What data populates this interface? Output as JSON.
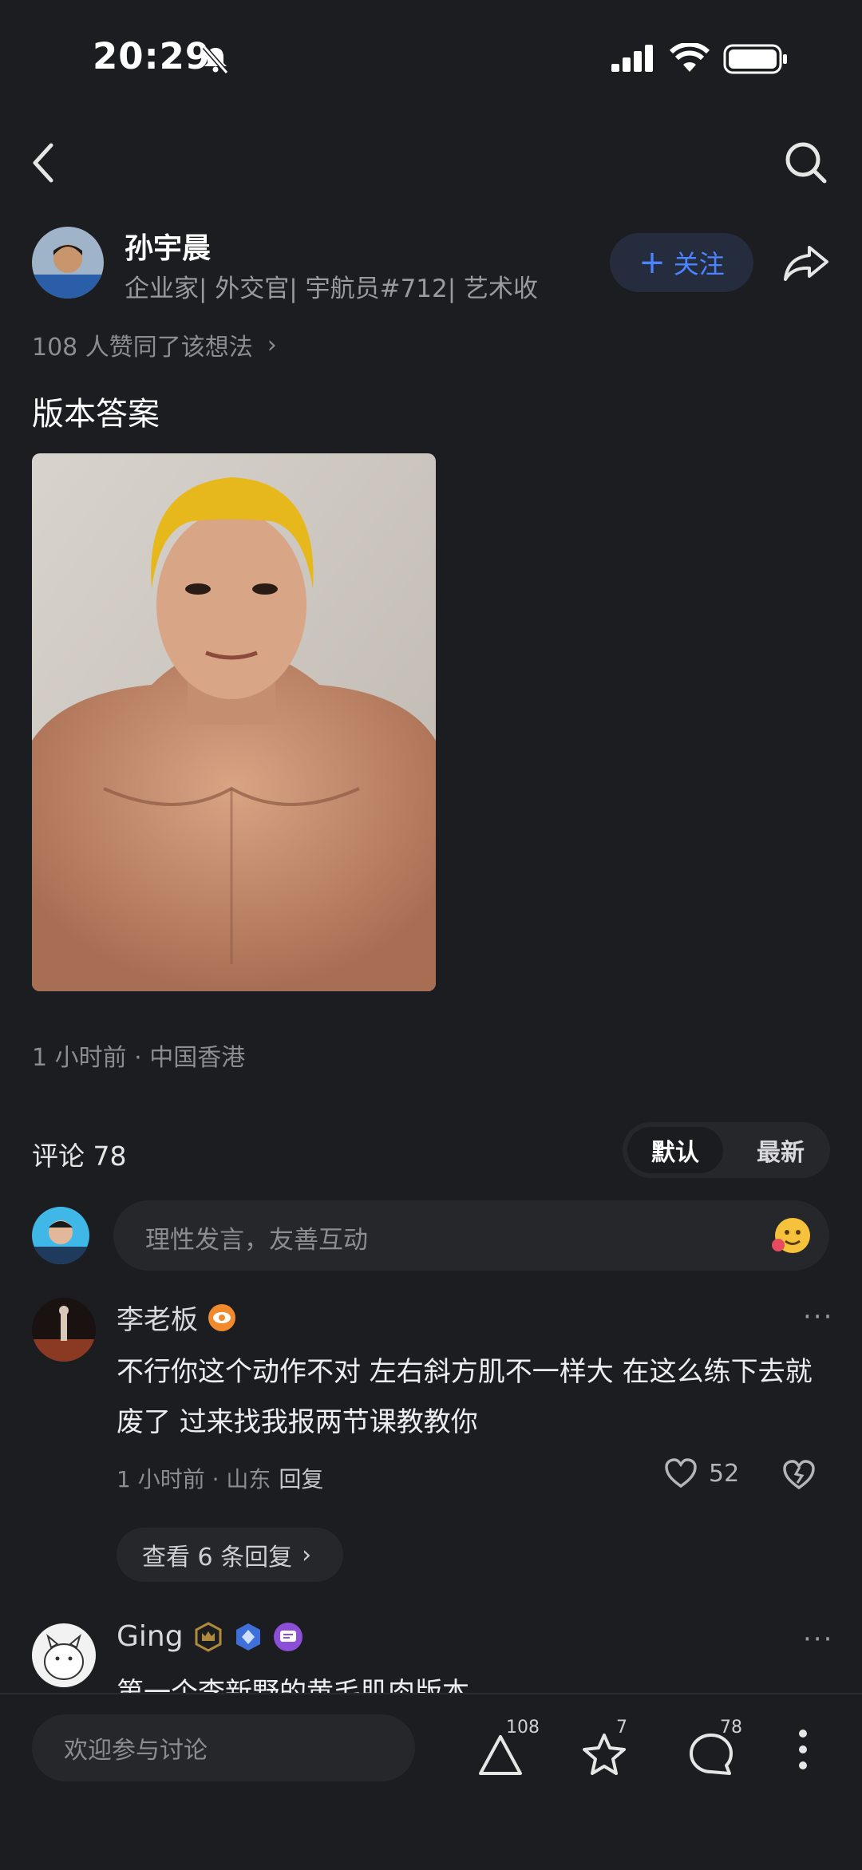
{
  "status_bar": {
    "time": "20:29"
  },
  "author": {
    "name": "孙宇晨",
    "bio": "企业家| 外交官| 宇航员#712| 艺术收",
    "follow_label": "关注"
  },
  "likes_summary": "108 人赞同了该想法",
  "post": {
    "text": "版本答案",
    "meta": "1 小时前 · 中国香港"
  },
  "comments": {
    "header": "评论 78",
    "sort_options": [
      "默认",
      "最新"
    ],
    "input_placeholder": "理性发言，友善互动",
    "items": [
      {
        "user": "李老板",
        "text": "不行你这个动作不对 左右斜方肌不一样大 在这么练下去就废了 过来找我报两节课教教你",
        "meta": "1 小时前 · 山东",
        "reply_label": "回复",
        "likes": "52",
        "view_replies": "查看 6 条回复"
      },
      {
        "user": "Ging",
        "text": "第一个李新野的黄毛肌肉版本"
      }
    ]
  },
  "bottom_bar": {
    "placeholder": "欢迎参与讨论",
    "like_count": "108",
    "star_count": "7",
    "comment_count": "78"
  },
  "colors": {
    "background": "#1c1d20",
    "accent": "#4c84ff"
  }
}
